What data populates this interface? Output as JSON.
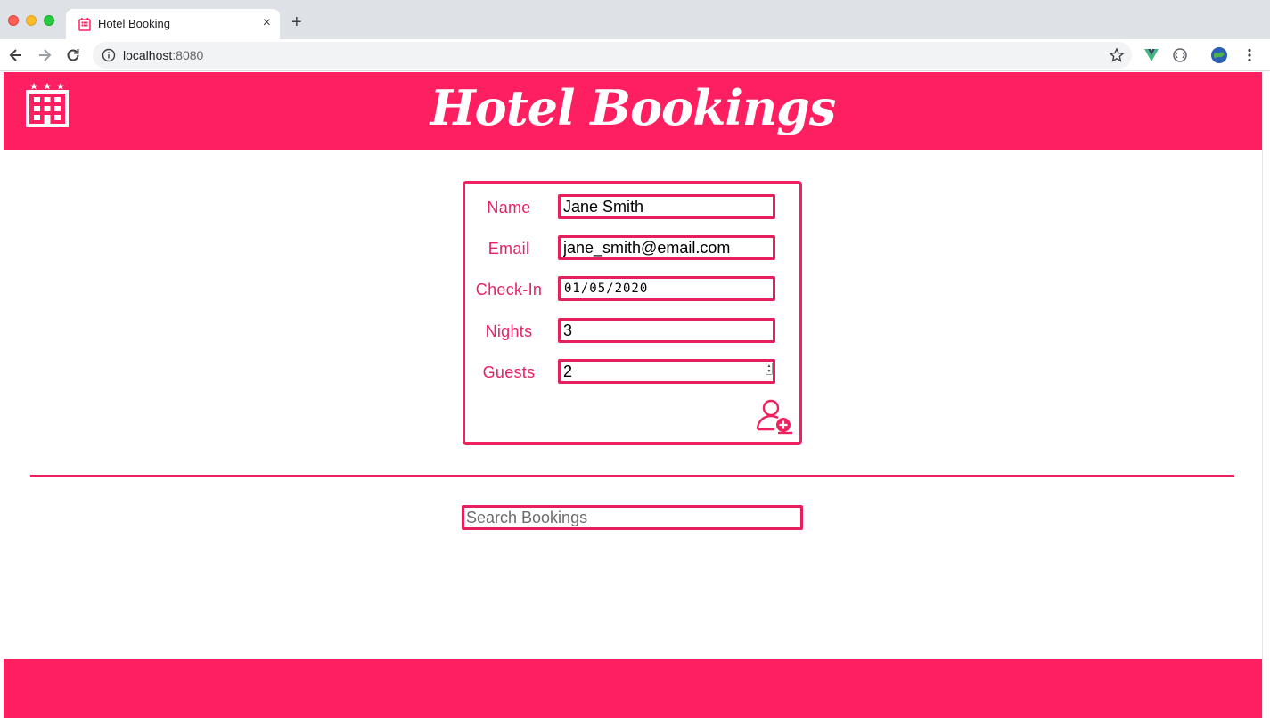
{
  "browser": {
    "tab_title": "Hotel Booking",
    "tab_close": "×",
    "new_tab": "+",
    "url_host": "localhost",
    "url_port": ":8080"
  },
  "header": {
    "title": "Hotel Bookings",
    "logo_icon": "hotel-building-icon"
  },
  "form": {
    "fields": [
      {
        "label": "Name",
        "value": "Jane Smith"
      },
      {
        "label": "Email",
        "value": "jane_smith@email.com"
      },
      {
        "label": "Check-In",
        "value": "01/05/2020"
      },
      {
        "label": "Nights",
        "value": "3"
      },
      {
        "label": "Guests",
        "value": "2"
      }
    ],
    "submit_icon": "add-user-icon"
  },
  "search": {
    "placeholder": "Search Bookings"
  },
  "colors": {
    "brand": "#fd1f5f",
    "accent": "#e61f5d"
  }
}
